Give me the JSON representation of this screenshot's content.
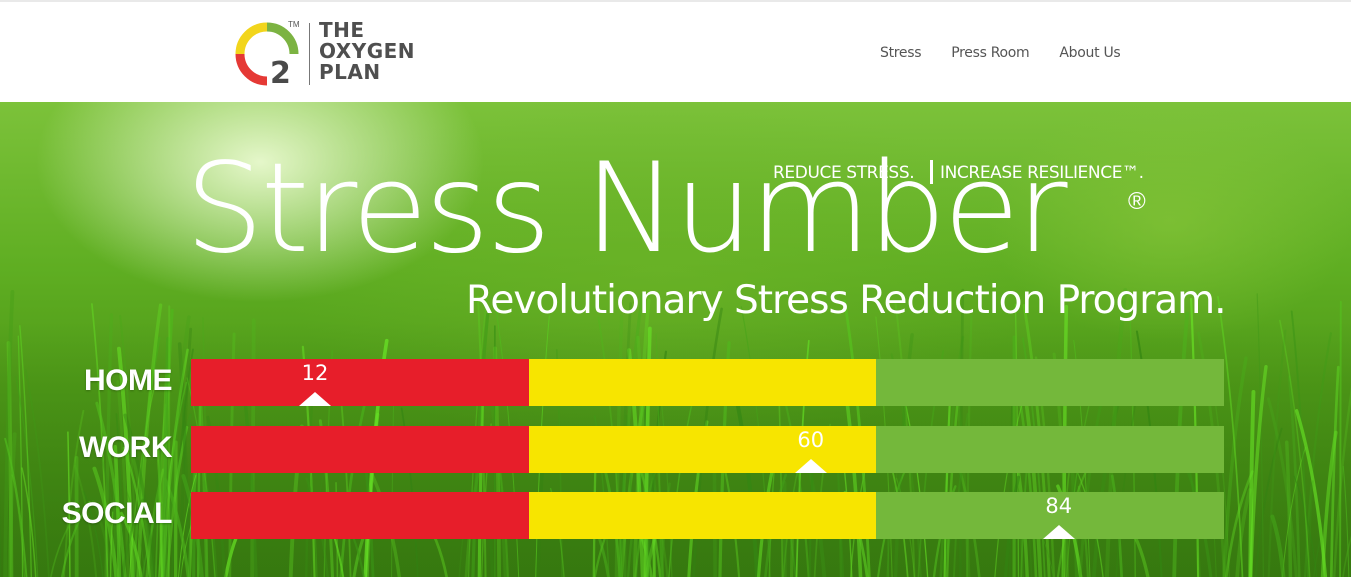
{
  "brand": {
    "mark_number": "2",
    "trademark": "TM",
    "name_lines": [
      "THE",
      "OXYGEN",
      "PLAN"
    ],
    "colors": {
      "yellow": "#f2d51c",
      "green": "#7cb342",
      "red": "#e53935",
      "gray": "#4f4f4f"
    }
  },
  "nav": {
    "items": [
      {
        "label": "Stress"
      },
      {
        "label": "Press Room"
      },
      {
        "label": "About Us"
      }
    ]
  },
  "hero": {
    "tagline_left": "REDUCE STRESS.",
    "tagline_right": "INCREASE RESILIENCE™.",
    "title": "Stress Number",
    "registered": "®",
    "subtitle": "Revolutionary Stress Reduction Program."
  },
  "scale": {
    "min": 0,
    "max": 100,
    "zones": [
      {
        "name": "red",
        "color": "#e71e2a",
        "from": 0,
        "to": 33
      },
      {
        "name": "yellow",
        "color": "#f7e500",
        "from": 33,
        "to": 66
      },
      {
        "name": "green",
        "color": "#74b83b",
        "from": 66,
        "to": 100
      }
    ]
  },
  "scores": [
    {
      "label": "HOME",
      "value": 12
    },
    {
      "label": "WORK",
      "value": 60
    },
    {
      "label": "SOCIAL",
      "value": 84
    }
  ]
}
